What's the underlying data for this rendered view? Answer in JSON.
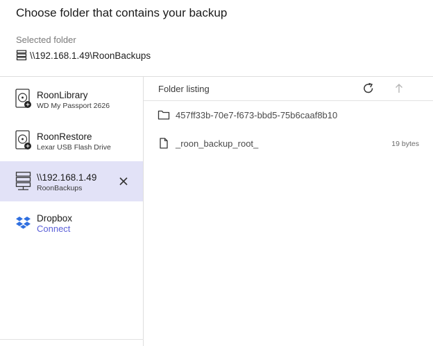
{
  "dialog": {
    "title": "Choose folder that contains your backup",
    "selected_label": "Selected folder",
    "selected_path": "\\\\192.168.1.49\\RoonBackups",
    "selected_icon": "server-icon"
  },
  "sidebar": {
    "items": [
      {
        "name": "RoonLibrary",
        "sub": "WD My Passport 2626",
        "icon": "hard-drive-icon"
      },
      {
        "name": "RoonRestore",
        "sub": "Lexar USB Flash Drive",
        "icon": "hard-drive-icon"
      },
      {
        "name": "\\\\192.168.1.49",
        "sub": "RoonBackups",
        "icon": "server-icon",
        "selected": true,
        "close_icon": "close-icon"
      },
      {
        "name": "Dropbox",
        "sub": "Connect",
        "icon": "dropbox-icon"
      }
    ]
  },
  "listing": {
    "title": "Folder listing",
    "refresh_icon": "refresh-icon",
    "up_icon": "arrow-up-icon",
    "entries": [
      {
        "name": "457ff33b-70e7-f673-bbd5-75b6caaf8b10",
        "type": "folder",
        "size": "",
        "icon": "folder-icon"
      },
      {
        "name": "_roon_backup_root_",
        "type": "file",
        "size": "19 bytes",
        "icon": "file-icon"
      }
    ]
  },
  "colors": {
    "selected_bg": "#e2e2f7",
    "link": "#5a5fd8",
    "dropbox": "#2f6fe0",
    "divider": "#dedede"
  }
}
